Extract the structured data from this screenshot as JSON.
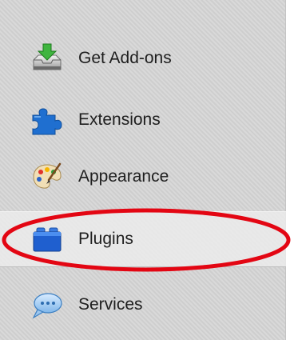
{
  "sidebar": {
    "items": [
      {
        "label": "Get Add-ons",
        "icon": "download-to-tray-icon",
        "selected": false
      },
      {
        "label": "Extensions",
        "icon": "puzzle-piece-icon",
        "selected": false
      },
      {
        "label": "Appearance",
        "icon": "paint-palette-icon",
        "selected": false
      },
      {
        "label": "Plugins",
        "icon": "lego-brick-icon",
        "selected": true
      },
      {
        "label": "Services",
        "icon": "speech-bubble-icon",
        "selected": false
      }
    ]
  },
  "colors": {
    "sidebar_background": "#d5d5d5",
    "selected_background": "#ebebeb",
    "annotation_ring": "#e30613",
    "text": "#1e1e1e"
  }
}
